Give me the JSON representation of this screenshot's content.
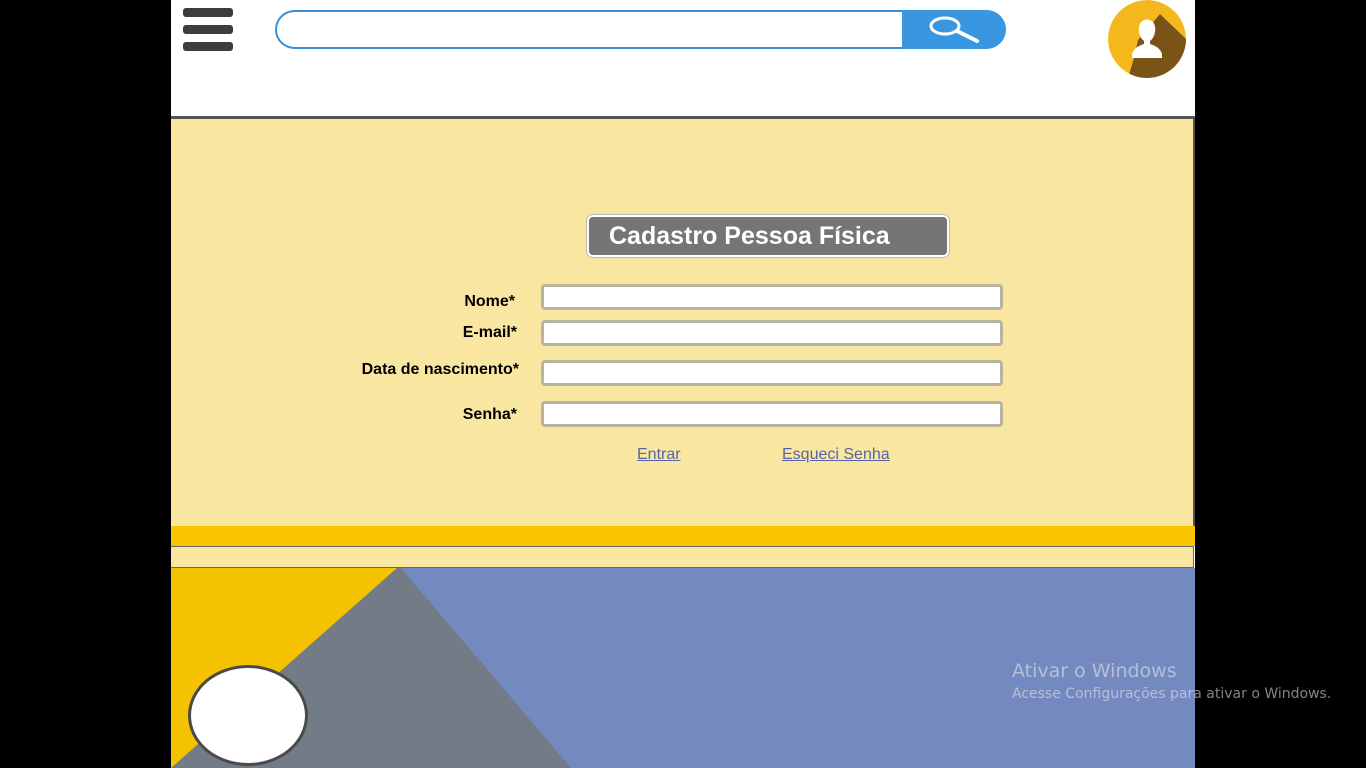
{
  "header": {
    "search_placeholder": ""
  },
  "form": {
    "title": "Cadastro Pessoa Física",
    "fields": [
      {
        "label": "Nome*",
        "value": ""
      },
      {
        "label": "E-mail*",
        "value": ""
      },
      {
        "label": "Data de nascimento*",
        "value": ""
      },
      {
        "label": "Senha*",
        "value": ""
      }
    ],
    "links": {
      "login": "Entrar",
      "forgot_password": "Esqueci Senha"
    }
  },
  "watermark": {
    "title": "Ativar o Windows",
    "subtitle": "Acesse Configurações para ativar o Windows."
  },
  "icons": {
    "menu": "hamburger-menu-icon",
    "search": "magnifier-icon",
    "user": "user-avatar-icon"
  },
  "colors": {
    "panel": "#f9e7a1",
    "accent_yellow": "#fbc400",
    "search_blue": "#3897e0",
    "title_gray": "#757575",
    "art_blue": "#7589c1",
    "art_gray": "#737b86",
    "art_yellow": "#f4c200"
  }
}
